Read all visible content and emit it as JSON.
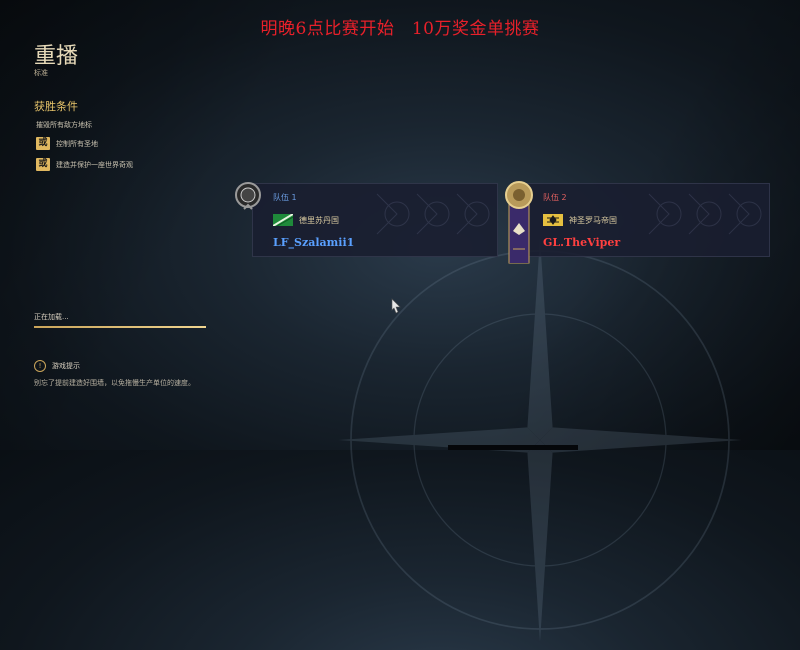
{
  "banner": "明晚6点比赛开始　10万奖金单挑赛",
  "page": {
    "title": "重播",
    "subtitle": "标准"
  },
  "victory": {
    "title": "获胜条件",
    "conditions": [
      {
        "text": "摧毁所有敌方地标",
        "badge": ""
      },
      {
        "text": "控制所有圣地",
        "badge": "或"
      },
      {
        "text": "建造并保护一座世界奇观",
        "badge": "或"
      }
    ]
  },
  "loading": {
    "text": "正在加载...",
    "progress": 1.0
  },
  "tip": {
    "title": "游戏提示",
    "body": "别忘了提前建造好围墙，以免拖慢生产单位的速度。"
  },
  "teams": [
    {
      "label": "队伍 1",
      "civ": "德里苏丹国",
      "player": "LF_Szalamii1",
      "label_color": "#6a9be0",
      "player_color": "#5aa0ff"
    },
    {
      "label": "队伍 2",
      "civ": "神圣罗马帝国",
      "player": "GL.TheViper",
      "label_color": "#e06060",
      "player_color": "#ff4040"
    }
  ]
}
